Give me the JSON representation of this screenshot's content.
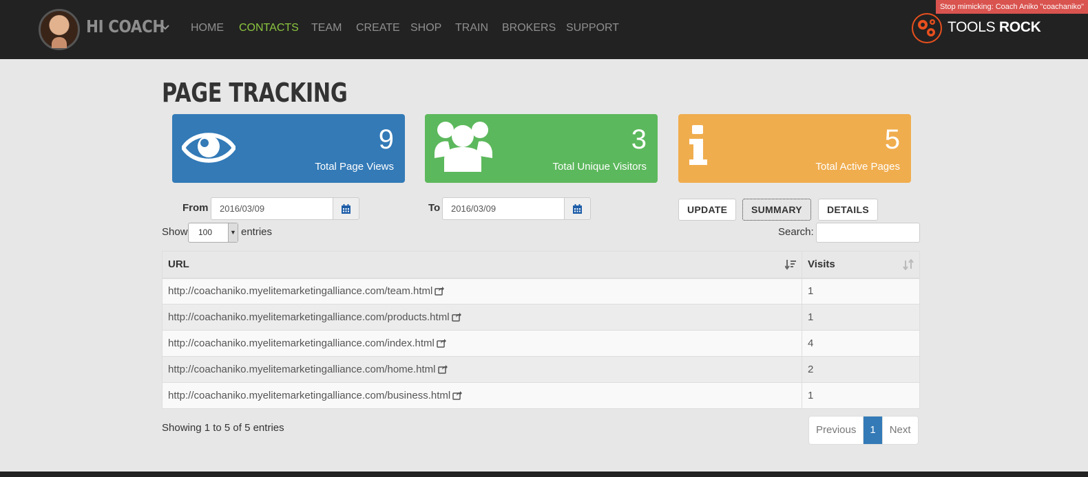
{
  "navbar": {
    "brand": "HI COACH",
    "links": [
      "HOME",
      "CONTACTS",
      "TEAM",
      "CREATE",
      "SHOP",
      "TRAIN",
      "BROKERS",
      "SUPPORT"
    ],
    "active_link": "CONTACTS",
    "mimic_notice": "Stop mimicking: Coach Aniko \"coachaniko\"",
    "logo": {
      "light": "TOOLS ",
      "bold": "ROCK"
    }
  },
  "page": {
    "title": "PAGE TRACKING"
  },
  "stats": [
    {
      "value": "9",
      "label": "Total Page Views",
      "icon": "eye-icon",
      "color": "#337ab7"
    },
    {
      "value": "3",
      "label": "Total Unique Visitors",
      "icon": "users-icon",
      "color": "#5cb85c"
    },
    {
      "value": "5",
      "label": "Total Active Pages",
      "icon": "info-icon",
      "color": "#f0ad4e"
    }
  ],
  "filters": {
    "from_label": "From",
    "from_value": "2016/03/09",
    "to_label": "To",
    "to_value": "2016/03/09",
    "buttons": {
      "update": "UPDATE",
      "summary": "SUMMARY",
      "details": "DETAILS"
    }
  },
  "table_controls": {
    "show_label": "Show",
    "entries_label": "entries",
    "length_value": "100",
    "search_label": "Search:"
  },
  "table": {
    "columns": [
      "URL",
      "Visits"
    ],
    "rows": [
      {
        "url": "http://coachaniko.myelitemarketingalliance.com/team.html",
        "visits": "1"
      },
      {
        "url": "http://coachaniko.myelitemarketingalliance.com/products.html",
        "visits": "1"
      },
      {
        "url": "http://coachaniko.myelitemarketingalliance.com/index.html",
        "visits": "4"
      },
      {
        "url": "http://coachaniko.myelitemarketingalliance.com/home.html",
        "visits": "2"
      },
      {
        "url": "http://coachaniko.myelitemarketingalliance.com/business.html",
        "visits": "1"
      }
    ]
  },
  "footer": {
    "info": "Showing 1 to 5 of 5 entries",
    "pagination": {
      "previous": "Previous",
      "current": "1",
      "next": "Next"
    }
  },
  "colors": {
    "nav_bg": "#222222",
    "active_link": "#8cc63f",
    "page_bg": "#e7e7e7",
    "mimic_bg": "#d9534f"
  }
}
